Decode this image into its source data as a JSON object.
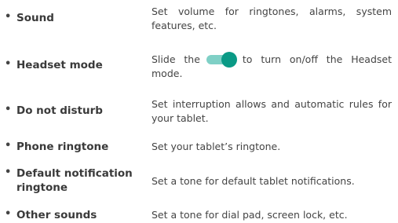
{
  "bullet": "•",
  "items": [
    {
      "term": "Sound",
      "desc": "Set volume for ringtones, alarms, system features, etc."
    },
    {
      "term": "Headset mode",
      "desc_before": "Slide the",
      "desc_after": "to turn on/off the Headset mode.",
      "toggle_state": "on"
    },
    {
      "term": "Do not disturb",
      "desc": "Set interruption allows and automatic rules for your tablet."
    },
    {
      "term": "Phone ringtone",
      "desc": "Set your tablet’s ringtone."
    },
    {
      "term_line1": "Default notification",
      "term_line2": "ringtone",
      "desc": "Set a tone for default tablet notifications."
    },
    {
      "term": "Other sounds",
      "desc": "Set a tone for dial pad, screen lock, etc."
    }
  ],
  "colors": {
    "toggle_track": "#7fd0c6",
    "toggle_knob": "#0a9a86"
  }
}
